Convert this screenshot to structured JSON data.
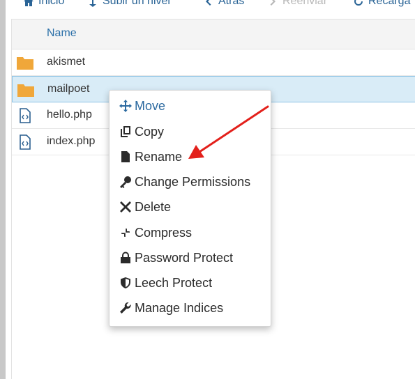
{
  "toolbar": {
    "items": [
      {
        "label": "Inicio",
        "icon": "home-icon"
      },
      {
        "label": "Subir un nivel",
        "icon": "level-up-icon"
      },
      {
        "label": "Atrás",
        "icon": "arrow-left-icon"
      },
      {
        "label": "Reenviar",
        "icon": "arrow-right-icon",
        "disabled": true
      },
      {
        "label": "Recarga",
        "icon": "reload-icon"
      }
    ]
  },
  "table": {
    "column_name": "Name",
    "rows": [
      {
        "name": "akismet",
        "type": "folder",
        "selected": false
      },
      {
        "name": "mailpoet",
        "type": "folder",
        "selected": true
      },
      {
        "name": "hello.php",
        "type": "php-file",
        "selected": false
      },
      {
        "name": "index.php",
        "type": "php-file",
        "selected": false
      }
    ]
  },
  "context_menu": {
    "items": [
      {
        "label": "Move",
        "icon": "move-icon",
        "active": true
      },
      {
        "label": "Copy",
        "icon": "copy-icon"
      },
      {
        "label": "Rename",
        "icon": "file-icon"
      },
      {
        "label": "Change Permissions",
        "icon": "key-icon"
      },
      {
        "label": "Delete",
        "icon": "x-icon"
      },
      {
        "label": "Compress",
        "icon": "compress-icon"
      },
      {
        "label": "Password Protect",
        "icon": "lock-icon"
      },
      {
        "label": "Leech Protect",
        "icon": "shield-icon"
      },
      {
        "label": "Manage Indices",
        "icon": "wrench-icon"
      }
    ]
  },
  "colors": {
    "link": "#2a6496",
    "folder": "#f0a73a",
    "selected_row": "#d9ecf7",
    "annotation_arrow": "#e3201b"
  }
}
